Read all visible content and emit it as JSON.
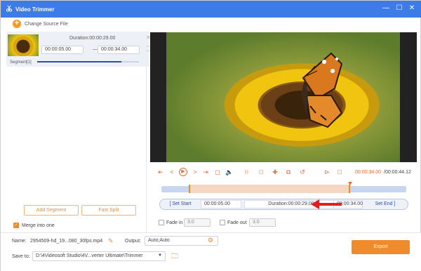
{
  "window": {
    "title": "Video Trimmer",
    "accent": "#3d7be6",
    "controls": [
      "minimize-icon",
      "maximize-icon",
      "close-icon"
    ]
  },
  "toolbar": {
    "change_source_label": "Change Source File",
    "add_icon": "plus-icon"
  },
  "segment": {
    "duration": "Duration:00:00:29.00",
    "start": "00:00:05.00",
    "end": "00:00:34.00",
    "label": "Segment[1]",
    "separator": "—"
  },
  "left_buttons": {
    "add_segment": "Add Segment",
    "fast_split": "Fast Split",
    "merge_label": "Merge into one",
    "merge_checked": true
  },
  "player": {
    "current_time": "00:00:34.00",
    "total_time": "/00:00:44.12",
    "progress": 0.77
  },
  "trim": {
    "set_start": "Set Start",
    "start_value": "00:00:05.00",
    "duration": "Duration:00:00:29.00",
    "end_value": "00:00:34.00",
    "set_end": "Set End",
    "selection_start": 0.113,
    "selection_end": 0.77
  },
  "fade": {
    "fade_in_label": "Fade in",
    "fade_in_value": "3.0",
    "fade_out_label": "Fade out",
    "fade_out_value": "3.0"
  },
  "output": {
    "name_label": "Name:",
    "name_value": "2954509-hd_19...080_30fps.mp4",
    "output_label": "Output:",
    "output_value": "Auto;Auto",
    "save_label": "Save to:",
    "save_value": "D:\\4Videosoft Studio\\4V...verter Ultimate\\Trimmer",
    "export_label": "Export"
  },
  "colors": {
    "orange": "#f08b2c",
    "blue_dark": "#2f4ea7",
    "arrow_red": "#e02020"
  }
}
